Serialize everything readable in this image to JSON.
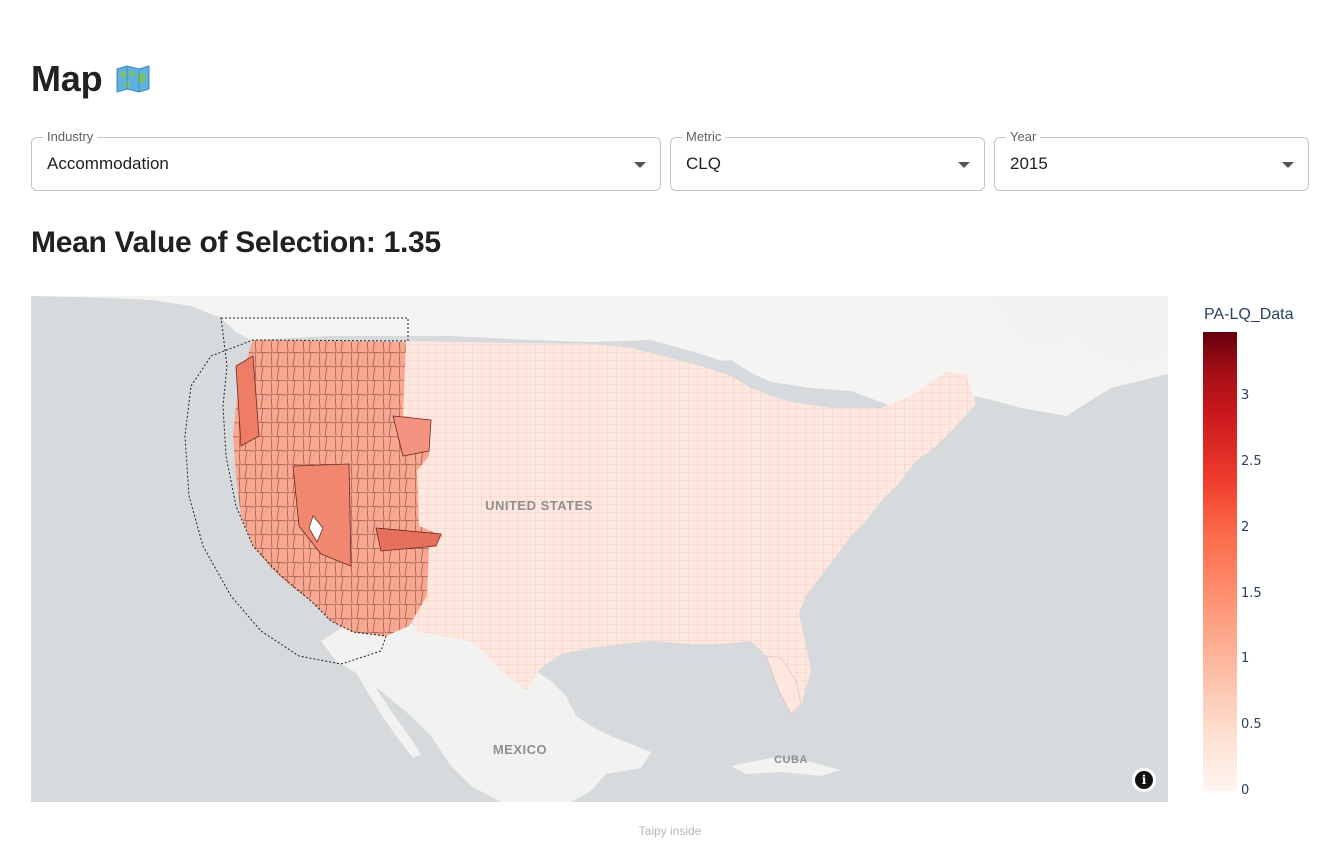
{
  "page": {
    "title": "Map",
    "title_icon": "world-map-icon",
    "mean_label": "Mean Value of Selection: 1.35"
  },
  "selectors": {
    "industry": {
      "label": "Industry",
      "value": "Accommodation"
    },
    "metric": {
      "label": "Metric",
      "value": "CLQ"
    },
    "year": {
      "label": "Year",
      "value": "2015"
    }
  },
  "map": {
    "labels": [
      "UNITED STATES",
      "MEXICO",
      "CUBA"
    ],
    "info_icon": "info-icon",
    "colorscale": [
      "#fff5f0",
      "#fee0d2",
      "#fcbba1",
      "#fc9272",
      "#fb6a4a",
      "#ef3b2c",
      "#cb181d",
      "#a50f15",
      "#67000d"
    ]
  },
  "colorbar": {
    "title": "PA-LQ_Data",
    "ticks": [
      "3",
      "2.5",
      "2",
      "1.5",
      "1",
      "0.5",
      "0"
    ]
  },
  "footer": {
    "text": "Taipy inside"
  }
}
